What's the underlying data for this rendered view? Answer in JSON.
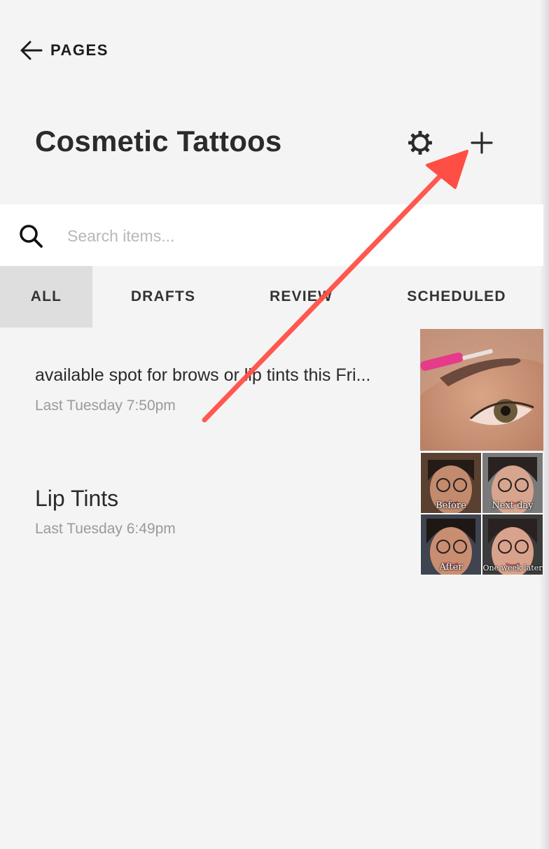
{
  "nav": {
    "back_label": "PAGES"
  },
  "page": {
    "title": "Cosmetic Tattoos"
  },
  "search": {
    "placeholder": "Search items..."
  },
  "tabs": [
    {
      "label": "ALL",
      "active": true
    },
    {
      "label": "DRAFTS",
      "active": false
    },
    {
      "label": "REVIEW",
      "active": false
    },
    {
      "label": "SCHEDULED",
      "active": false
    }
  ],
  "items": [
    {
      "title": "available spot for brows or lip tints this Fri...",
      "meta": "Last Tuesday 7:50pm",
      "thumbnail": "eyebrow-closeup-photo"
    },
    {
      "title": "Lip Tints",
      "meta": "Last Tuesday 6:49pm",
      "thumbnail": "before-after-collage",
      "collage_captions": [
        "Before",
        "Next day",
        "After",
        "One week later"
      ]
    }
  ],
  "icons": {
    "back": "arrow-left-icon",
    "settings": "gear-icon",
    "add": "plus-icon",
    "search": "search-icon"
  },
  "annotation": {
    "type": "arrow",
    "color": "#ff4f45",
    "points_to": "add-item-button"
  },
  "colors": {
    "background": "#f4f4f4",
    "active_tab": "#dedede",
    "annotation": "#ff4f45"
  }
}
